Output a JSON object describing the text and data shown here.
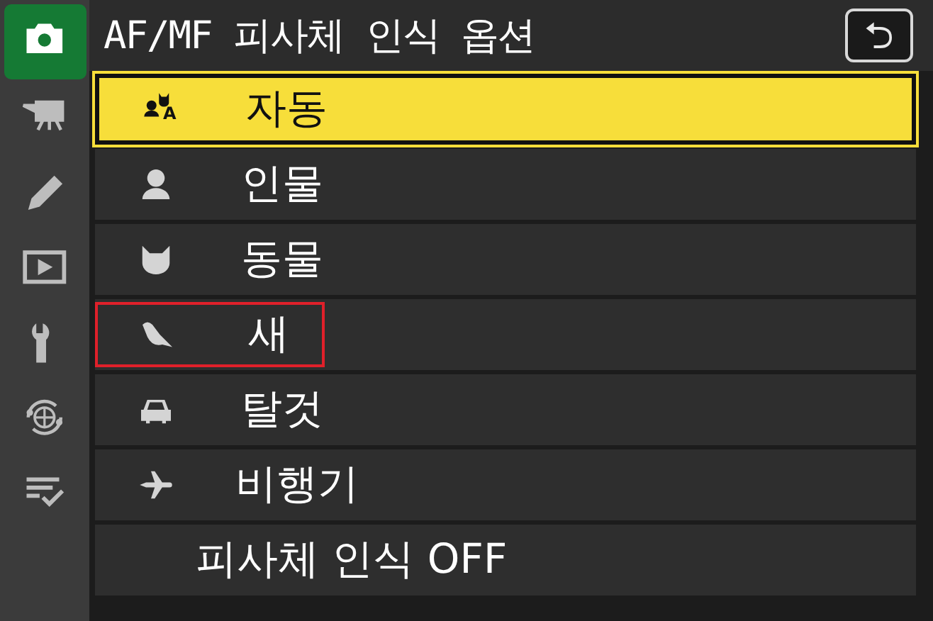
{
  "sidebar": {
    "items": [
      {
        "kind": "camera",
        "selected": true
      },
      {
        "kind": "movie",
        "selected": false
      },
      {
        "kind": "pencil",
        "selected": false
      },
      {
        "kind": "playback",
        "selected": false
      },
      {
        "kind": "wrench",
        "selected": false
      },
      {
        "kind": "network",
        "selected": false
      },
      {
        "kind": "mymenu",
        "selected": false
      }
    ]
  },
  "header": {
    "title": "AF/MF 피사체 인식 옵션",
    "back_button": "⮌"
  },
  "options": [
    {
      "kind": "auto",
      "icon_letter": "A",
      "label": "자동",
      "selected": true,
      "highlighted": false
    },
    {
      "kind": "person",
      "label": "인물",
      "selected": false,
      "highlighted": false
    },
    {
      "kind": "animal",
      "label": "동물",
      "selected": false,
      "highlighted": false
    },
    {
      "kind": "bird",
      "label": "새",
      "selected": false,
      "highlighted": true
    },
    {
      "kind": "car",
      "label": "탈것",
      "selected": false,
      "highlighted": false
    },
    {
      "kind": "plane",
      "label": "비행기",
      "selected": false,
      "highlighted": false
    },
    {
      "kind": "none",
      "label": "피사체 인식 OFF",
      "selected": false,
      "highlighted": false
    }
  ]
}
